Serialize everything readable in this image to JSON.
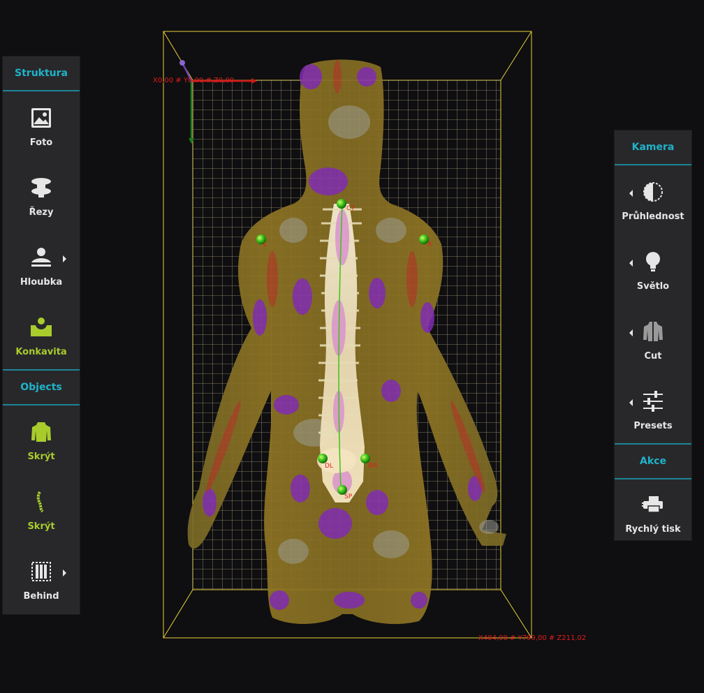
{
  "left_panel": {
    "sections": [
      {
        "title": "Struktura"
      },
      {
        "title": "Objects"
      }
    ],
    "tools": [
      {
        "label": "Foto",
        "icon": "photo-icon"
      },
      {
        "label": "Řezy",
        "icon": "vertebra-slices-icon"
      },
      {
        "label": "Hloubka",
        "icon": "depth-person-icon",
        "has_submenu": true
      },
      {
        "label": "Konkavita",
        "icon": "concavity-icon",
        "active": true
      },
      {
        "label": "Skrýt",
        "icon": "torso-icon",
        "active": true
      },
      {
        "label": "Skrýt",
        "icon": "spine-icon",
        "active": true
      },
      {
        "label": "Behind",
        "icon": "behind-frame-icon",
        "has_submenu": true
      }
    ]
  },
  "right_panel": {
    "sections": [
      {
        "title": "Kamera"
      },
      {
        "title": "Akce"
      }
    ],
    "tools": [
      {
        "label": "Průhlednost",
        "icon": "transparency-icon",
        "has_submenu": true
      },
      {
        "label": "Světlo",
        "icon": "lightbulb-icon",
        "has_submenu": true
      },
      {
        "label": "Cut",
        "icon": "cut-body-icon",
        "has_submenu": true
      },
      {
        "label": "Presets",
        "icon": "sliders-icon",
        "has_submenu": true
      },
      {
        "label": "Rychlý tisk",
        "icon": "printer-icon"
      }
    ]
  },
  "viewport": {
    "origin_coords": "X0,00 # Y0,00 # Z0,00",
    "extent_coords": "X404,00 # Y799,00 # Z211,02",
    "landmarks": [
      "C7",
      "L",
      "R",
      "DL",
      "DR",
      "SP"
    ]
  },
  "colors": {
    "accent": "#1fb3c9",
    "active": "#a8cc2c",
    "grid": "#d8d0a0",
    "box": "#e6d23a",
    "marker": "#2fbf1a",
    "body_base": "#8a7324",
    "body_purple": "#8a2fc0"
  }
}
